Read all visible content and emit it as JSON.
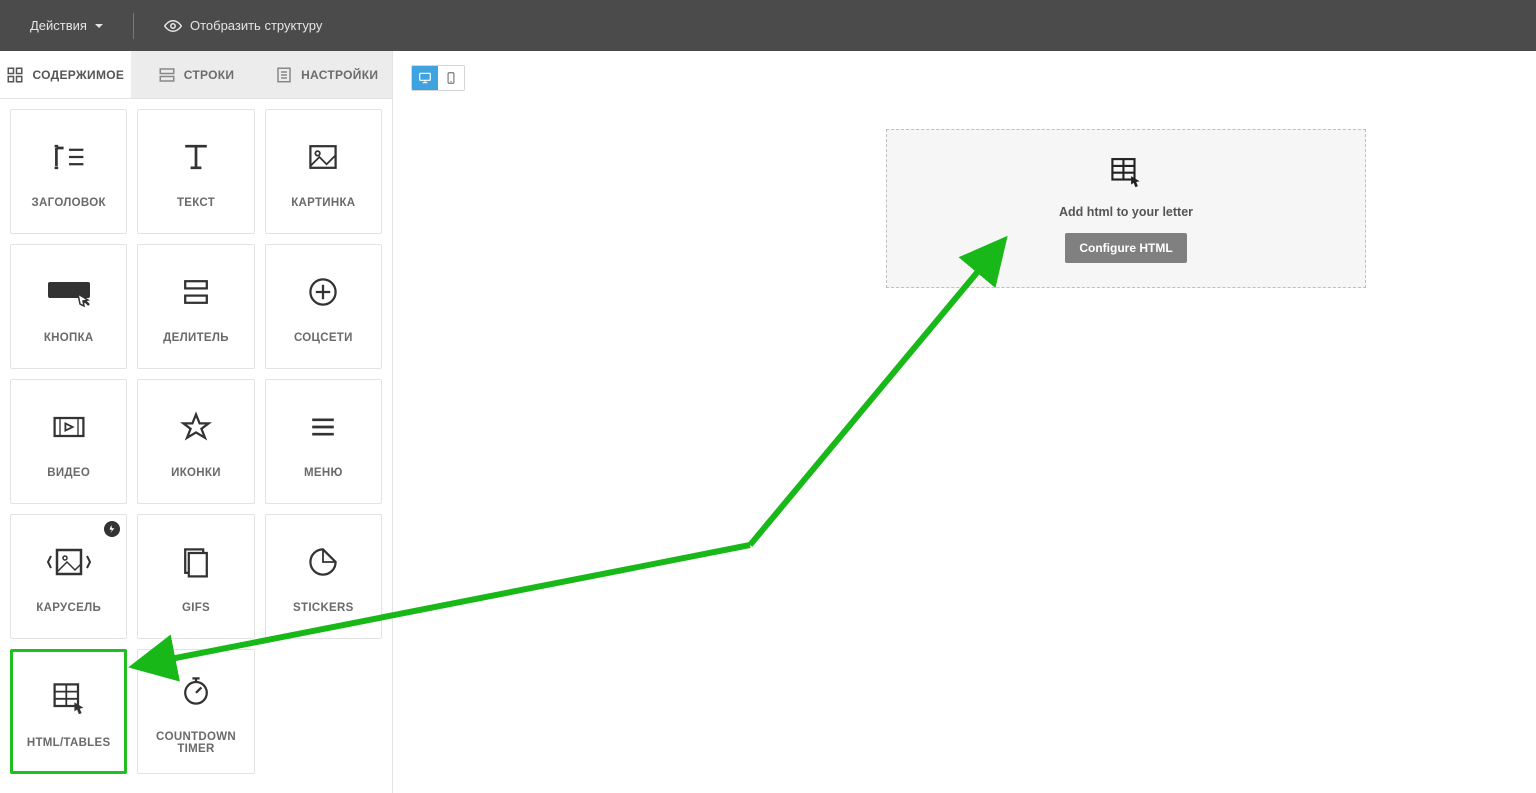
{
  "topbar": {
    "actions_label": "Действия",
    "structure_label": "Отобразить структуру"
  },
  "tabs": {
    "content": "СОДЕРЖИМОЕ",
    "rows": "СТРОКИ",
    "settings": "НАСТРОЙКИ"
  },
  "blocks": {
    "heading": "ЗАГОЛОВОК",
    "text": "ТЕКСТ",
    "image": "КАРТИНКА",
    "button": "КНОПКА",
    "divider": "ДЕЛИТЕЛЬ",
    "social": "СОЦСЕТИ",
    "video": "ВИДЕО",
    "icons": "ИКОНКИ",
    "menu": "МЕНЮ",
    "carousel": "КАРУСЕЛЬ",
    "gifs": "GIFS",
    "stickers": "STICKERS",
    "html_tables": "HTML/TABLES",
    "countdown": "COUNTDOWN TIMER"
  },
  "dropzone": {
    "text": "Add html to your letter",
    "button_label": "Configure HTML"
  },
  "annotation": {
    "color": "#18b818"
  }
}
